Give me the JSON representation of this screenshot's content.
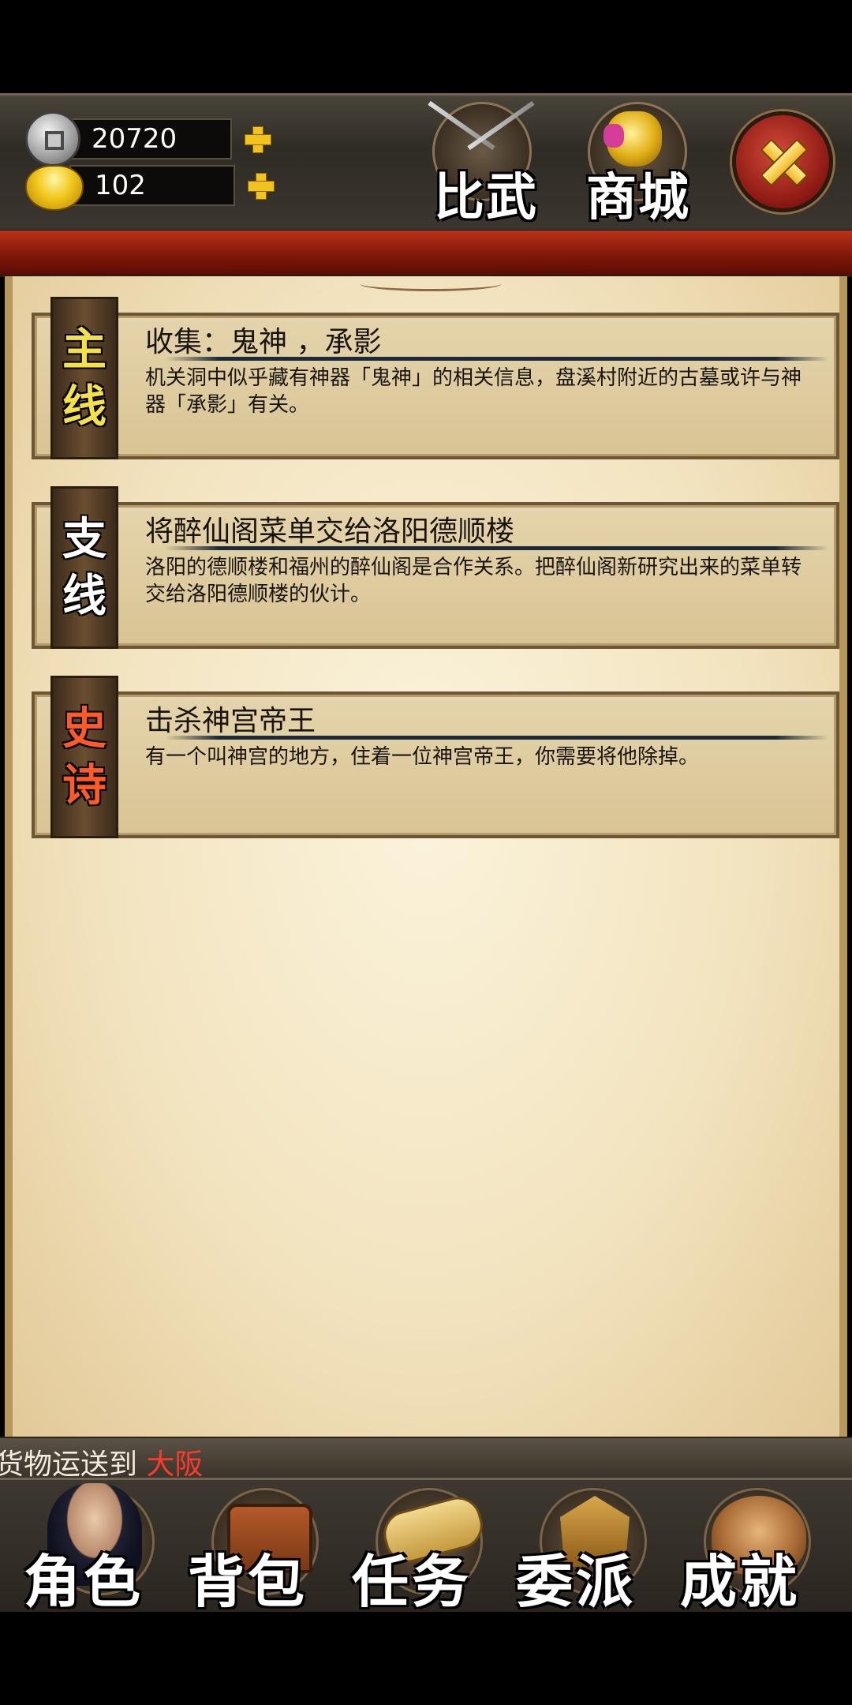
{
  "currency": {
    "silver": "20720",
    "gold": "102"
  },
  "top_nav": {
    "pvp_label": "比武",
    "shop_label": "商城"
  },
  "quests": [
    {
      "type_chars": [
        "主",
        "线"
      ],
      "title": "收集：鬼神 ，承影",
      "description": "机关洞中似乎藏有神器「鬼神」的相关信息，盘溪村附近的古墓或许与神器「承影」有关。"
    },
    {
      "type_chars": [
        "支",
        "线"
      ],
      "title": "将醉仙阁菜单交给洛阳德顺楼",
      "description": "洛阳的德顺楼和福州的醉仙阁是合作关系。把醉仙阁新研究出来的菜单转交给洛阳德顺楼的伙计。"
    },
    {
      "type_chars": [
        "史",
        "诗"
      ],
      "title": "击杀神宫帝王",
      "description": "有一个叫神宫的地方，住着一位神宫帝王，你需要将他除掉。"
    }
  ],
  "ticker": {
    "text": "货物运送到 ",
    "city": "大阪"
  },
  "bottom_nav": {
    "character": "角色",
    "bag": "背包",
    "quest": "任务",
    "dispatch": "委派",
    "achievement": "成就"
  },
  "colors": {
    "tag_main": "#f4e14a",
    "tag_side": "#ffffff",
    "tag_epic": "#ff5a2a",
    "ticker_city": "#ff3a2a"
  }
}
